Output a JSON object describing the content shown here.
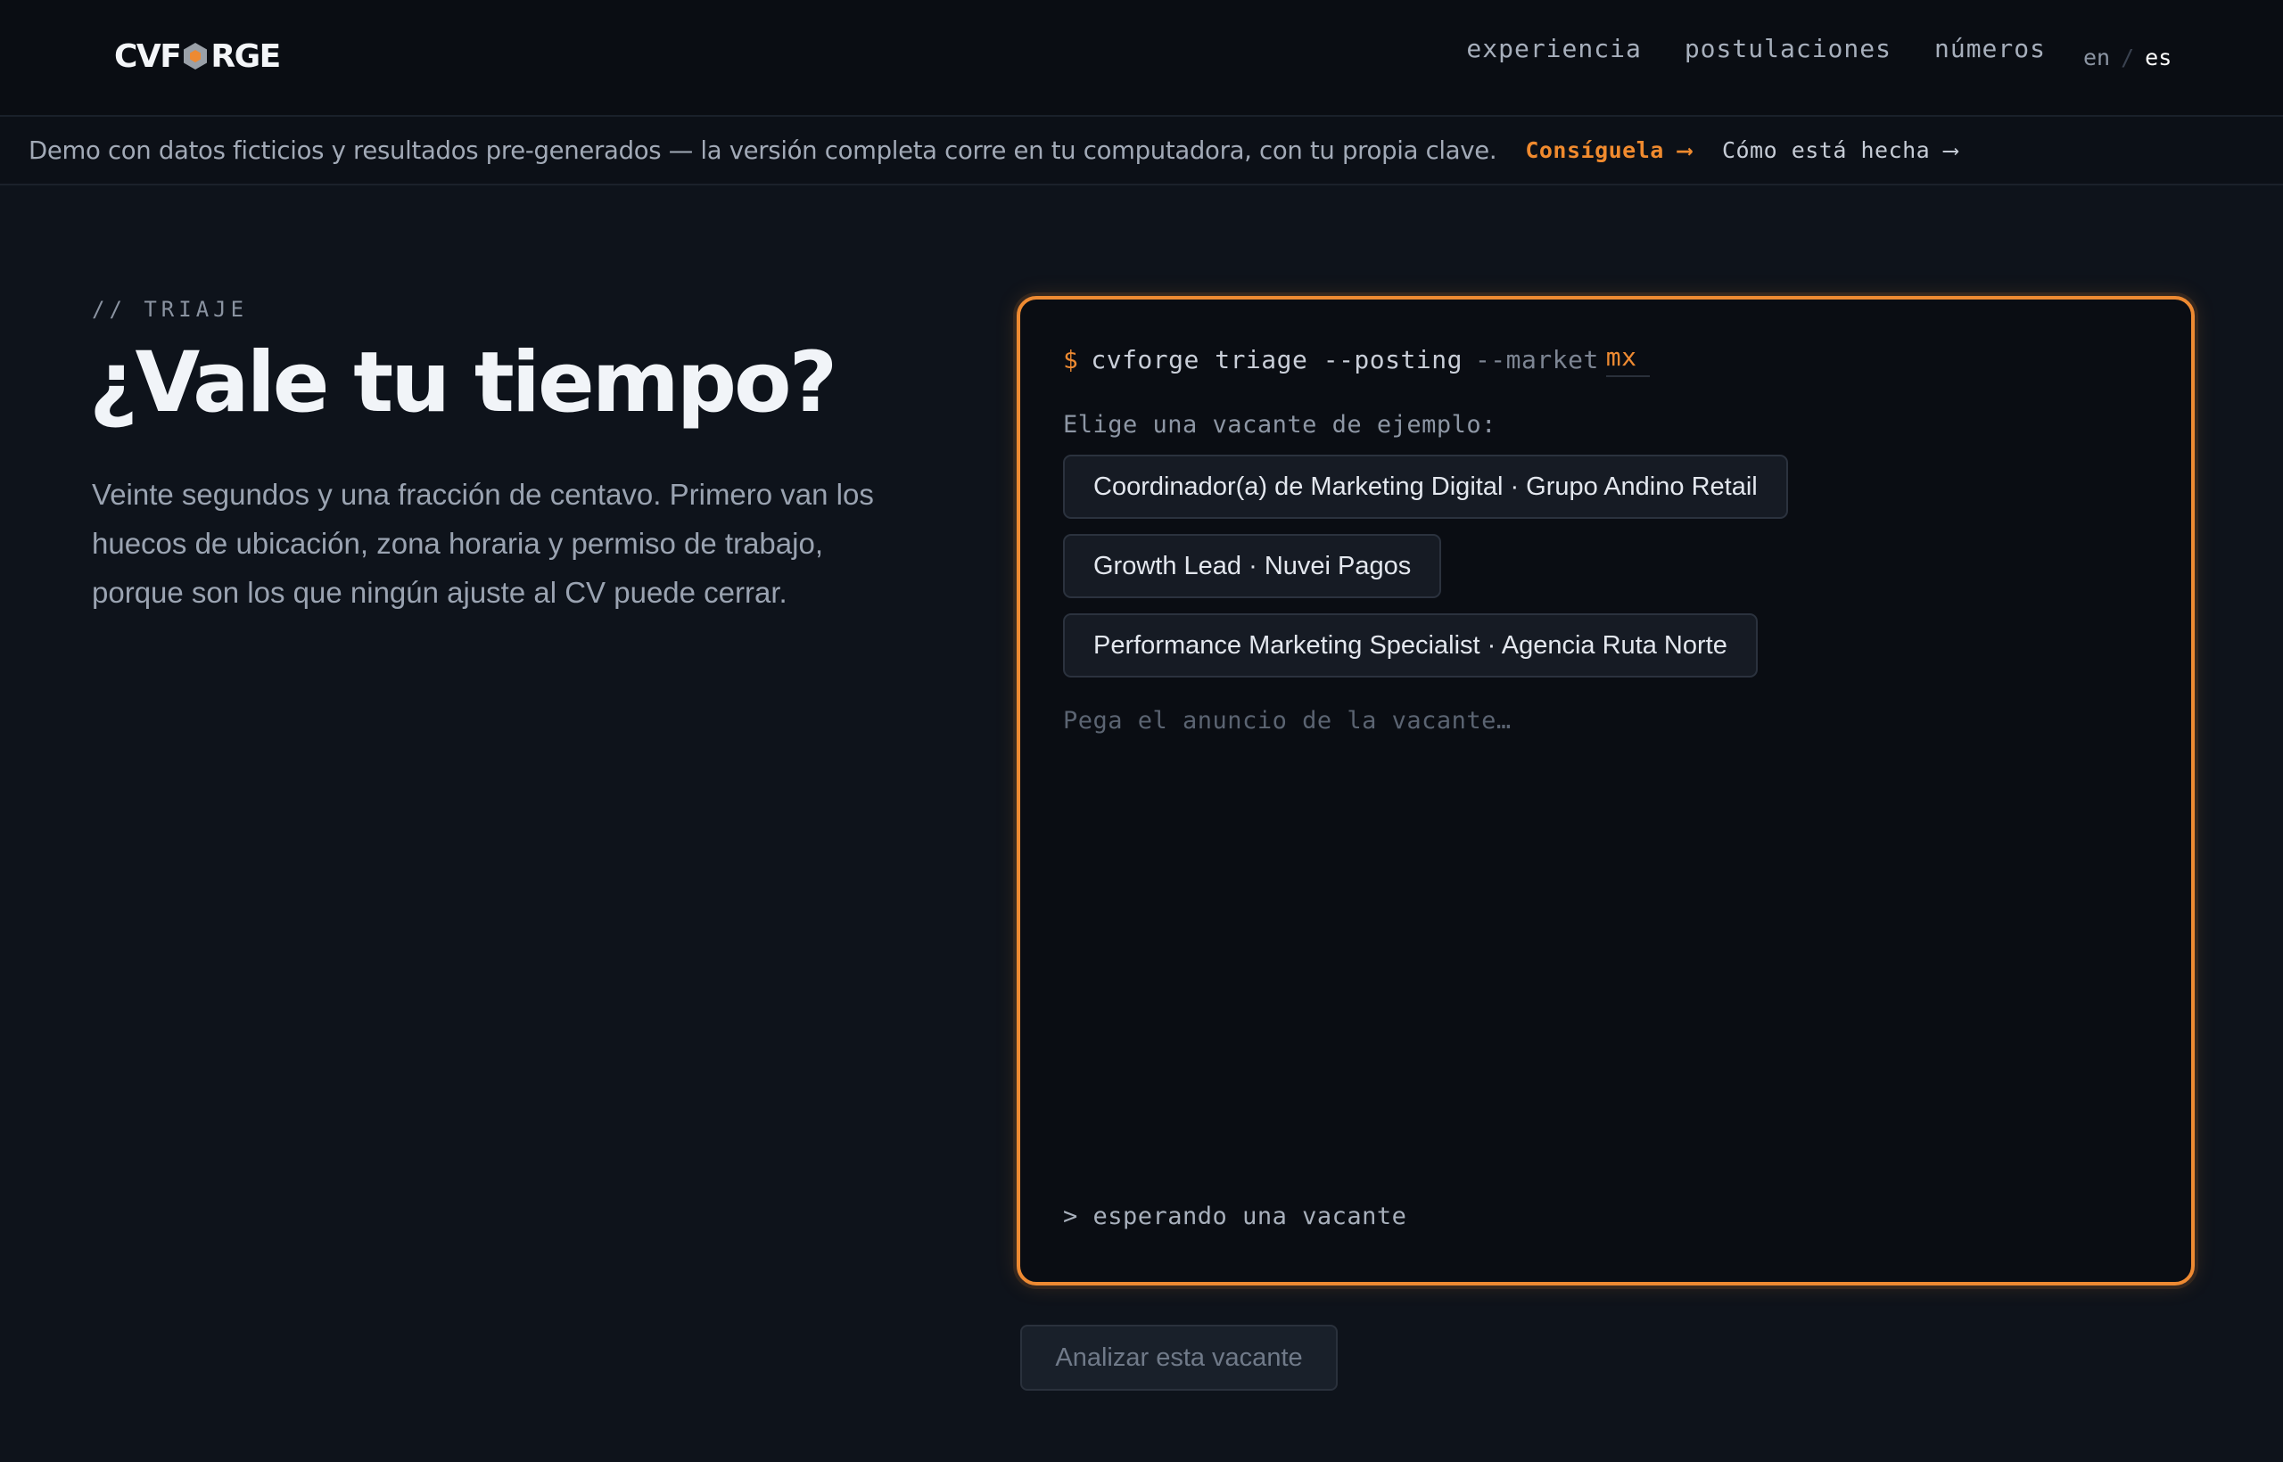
{
  "brand": {
    "name_left": "CVF",
    "name_right": "RGE",
    "logo_icon": "hexagon-icon"
  },
  "nav": {
    "links": [
      "experiencia",
      "postulaciones",
      "números"
    ],
    "lang": {
      "en": "en",
      "separator": "/",
      "es": "es",
      "active": "es"
    }
  },
  "banner": {
    "message": "Demo con datos ficticios y resultados pre-generados — la versión completa corre en tu computadora, con tu propia clave.",
    "cta": "Consíguela ⟶",
    "how": "Cómo está hecha ⟶"
  },
  "hero": {
    "eyebrow": "// TRIAJE",
    "title": "¿Vale tu tiempo?",
    "lede": "Veinte segundos y una fracción de centavo. Primero van los huecos de ubicación, zona horaria y permiso de trabajo, porque son los que ningún ajuste al CV puede cerrar."
  },
  "terminal": {
    "prompt": "$",
    "command": "cvforge triage --posting",
    "flag": "--market",
    "market_value": "mx",
    "pick_label": "Elige una vacante de ejemplo:",
    "samples": [
      "Coordinador(a) de Marketing Digital · Grupo Andino Retail",
      "Growth Lead · Nuvei Pagos",
      "Performance Marketing Specialist · Agencia Ruta Norte"
    ],
    "paste_placeholder": "Pega el anuncio de la vacante…",
    "paste_value": "",
    "status": "> esperando una vacante"
  },
  "actions": {
    "analyze_label": "Analizar esta vacante",
    "analyze_enabled": false
  },
  "colors": {
    "accent": "#ee8a32",
    "background": "#0e131b",
    "terminal_bg": "#0a0d13"
  }
}
